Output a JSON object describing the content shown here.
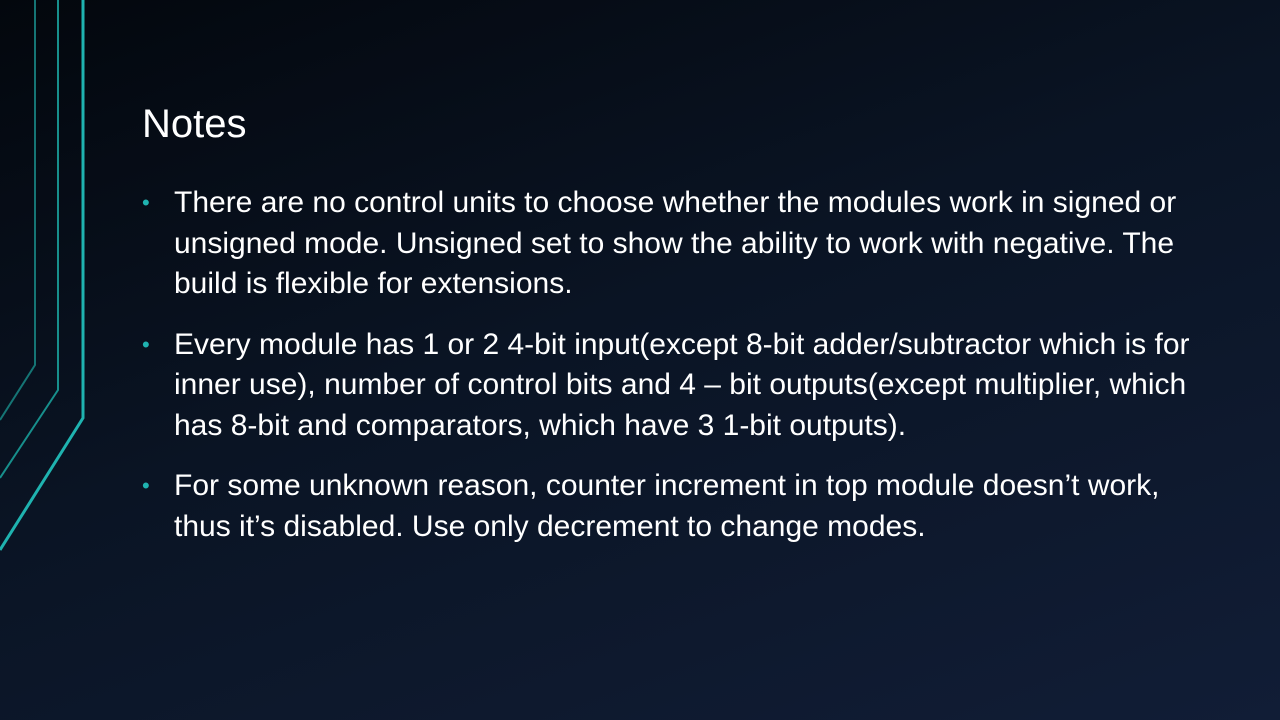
{
  "slide": {
    "title": "Notes",
    "bullet_glyph": "•",
    "accent_color": "#1fb3b0",
    "bullets": [
      "There are no control units to choose whether the modules work in signed or unsigned mode. Unsigned set to show the ability to work with negative. The build is flexible for extensions.",
      "Every module has 1 or 2 4-bit input(except 8-bit adder/subtractor which is for inner use), number of control bits and 4 – bit outputs(except multiplier, which has 8-bit and comparators, which have 3 1-bit outputs).",
      "For some unknown reason, counter increment in top module doesn’t work, thus it’s disabled. Use only decrement to change modes."
    ]
  }
}
